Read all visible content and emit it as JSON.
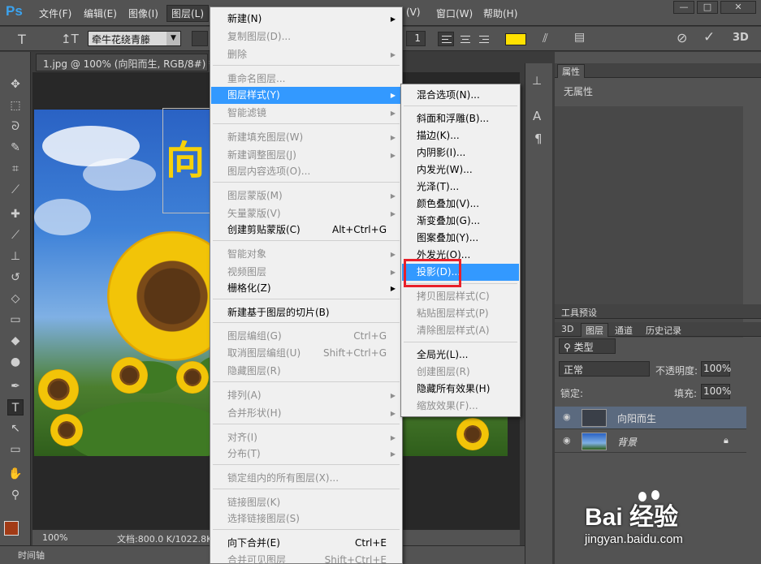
{
  "app": {
    "logo": "Ps"
  },
  "menubar": {
    "items": [
      "文件(F)",
      "编辑(E)",
      "图像(I)",
      "图层(L)",
      "(V)",
      "窗口(W)",
      "帮助(H)"
    ],
    "window_controls": [
      "—",
      "□",
      "✕"
    ]
  },
  "options": {
    "font": "牵牛花绕青籐",
    "size": "1",
    "color_hex": "#ffe100"
  },
  "document": {
    "tab": "1.jpg @ 100% (向阳而生, RGB/8#) *",
    "close": "×",
    "zoom": "100%",
    "doc_info": "文档:800.0 K/1022.8K",
    "canvas_text": "向阳"
  },
  "timeline": {
    "label": "时间轴"
  },
  "layer_menu": {
    "items": [
      {
        "label": "新建(N)",
        "shortcut": "",
        "arrow": true,
        "disabled": false
      },
      {
        "label": "复制图层(D)...",
        "shortcut": "",
        "arrow": false,
        "disabled": true
      },
      {
        "label": "删除",
        "shortcut": "",
        "arrow": true,
        "disabled": true
      },
      {
        "label": "重命名图层...",
        "shortcut": "",
        "arrow": false,
        "disabled": true
      },
      {
        "label": "图层样式(Y)",
        "shortcut": "",
        "arrow": true,
        "disabled": false,
        "highlight": true
      },
      {
        "label": "智能滤镜",
        "shortcut": "",
        "arrow": true,
        "disabled": true
      },
      {
        "label": "新建填充图层(W)",
        "shortcut": "",
        "arrow": true,
        "disabled": true
      },
      {
        "label": "新建调整图层(J)",
        "shortcut": "",
        "arrow": true,
        "disabled": true
      },
      {
        "label": "图层内容选项(O)...",
        "shortcut": "",
        "arrow": false,
        "disabled": true
      },
      {
        "label": "图层蒙版(M)",
        "shortcut": "",
        "arrow": true,
        "disabled": true
      },
      {
        "label": "矢量蒙版(V)",
        "shortcut": "",
        "arrow": true,
        "disabled": true
      },
      {
        "label": "创建剪贴蒙版(C)",
        "shortcut": "Alt+Ctrl+G",
        "arrow": false,
        "disabled": false
      },
      {
        "label": "智能对象",
        "shortcut": "",
        "arrow": true,
        "disabled": true
      },
      {
        "label": "视频图层",
        "shortcut": "",
        "arrow": true,
        "disabled": true
      },
      {
        "label": "栅格化(Z)",
        "shortcut": "",
        "arrow": true,
        "disabled": false
      },
      {
        "label": "新建基于图层的切片(B)",
        "shortcut": "",
        "arrow": false,
        "disabled": false
      },
      {
        "label": "图层编组(G)",
        "shortcut": "Ctrl+G",
        "arrow": false,
        "disabled": true
      },
      {
        "label": "取消图层编组(U)",
        "shortcut": "Shift+Ctrl+G",
        "arrow": false,
        "disabled": true
      },
      {
        "label": "隐藏图层(R)",
        "shortcut": "",
        "arrow": false,
        "disabled": true
      },
      {
        "label": "排列(A)",
        "shortcut": "",
        "arrow": true,
        "disabled": true
      },
      {
        "label": "合并形状(H)",
        "shortcut": "",
        "arrow": true,
        "disabled": true
      },
      {
        "label": "对齐(I)",
        "shortcut": "",
        "arrow": true,
        "disabled": true
      },
      {
        "label": "分布(T)",
        "shortcut": "",
        "arrow": true,
        "disabled": true
      },
      {
        "label": "锁定组内的所有图层(X)...",
        "shortcut": "",
        "arrow": false,
        "disabled": true
      },
      {
        "label": "链接图层(K)",
        "shortcut": "",
        "arrow": false,
        "disabled": true
      },
      {
        "label": "选择链接图层(S)",
        "shortcut": "",
        "arrow": false,
        "disabled": true
      },
      {
        "label": "向下合并(E)",
        "shortcut": "Ctrl+E",
        "arrow": false,
        "disabled": false
      },
      {
        "label": "合并可见图层",
        "shortcut": "Shift+Ctrl+E",
        "arrow": false,
        "disabled": true
      }
    ]
  },
  "style_submenu": {
    "items": [
      {
        "label": "混合选项(N)...",
        "disabled": false
      },
      {
        "label": "斜面和浮雕(B)...",
        "disabled": false
      },
      {
        "label": "描边(K)...",
        "disabled": false
      },
      {
        "label": "内阴影(I)...",
        "disabled": false
      },
      {
        "label": "内发光(W)...",
        "disabled": false
      },
      {
        "label": "光泽(T)...",
        "disabled": false
      },
      {
        "label": "颜色叠加(V)...",
        "disabled": false
      },
      {
        "label": "渐变叠加(G)...",
        "disabled": false
      },
      {
        "label": "图案叠加(Y)...",
        "disabled": false
      },
      {
        "label": "外发光(O)...",
        "disabled": false
      },
      {
        "label": "投影(D)...",
        "disabled": false,
        "highlight": true
      },
      {
        "label": "拷贝图层样式(C)",
        "disabled": true
      },
      {
        "label": "粘贴图层样式(P)",
        "disabled": true
      },
      {
        "label": "清除图层样式(A)",
        "disabled": true
      },
      {
        "label": "全局光(L)...",
        "disabled": false
      },
      {
        "label": "创建图层(R)",
        "disabled": true
      },
      {
        "label": "隐藏所有效果(H)",
        "disabled": false
      },
      {
        "label": "缩放效果(F)...",
        "disabled": true
      }
    ]
  },
  "properties_panel": {
    "title": "属性",
    "body": "无属性"
  },
  "presets_panel": {
    "title": "工具预设"
  },
  "layers_panel": {
    "tabs": [
      "3D",
      "图层",
      "通道",
      "历史记录"
    ],
    "filter": "类型",
    "blend_mode": "正常",
    "opacity_label": "不透明度:",
    "opacity": "100%",
    "lock_label": "锁定:",
    "fill_label": "填充:",
    "fill": "100%",
    "layers": [
      {
        "name": "向阳而生",
        "selected": true
      },
      {
        "name": "背景",
        "selected": false
      }
    ]
  },
  "watermark": {
    "brand": "Bai 经验",
    "url": "jingyan.baidu.com"
  }
}
